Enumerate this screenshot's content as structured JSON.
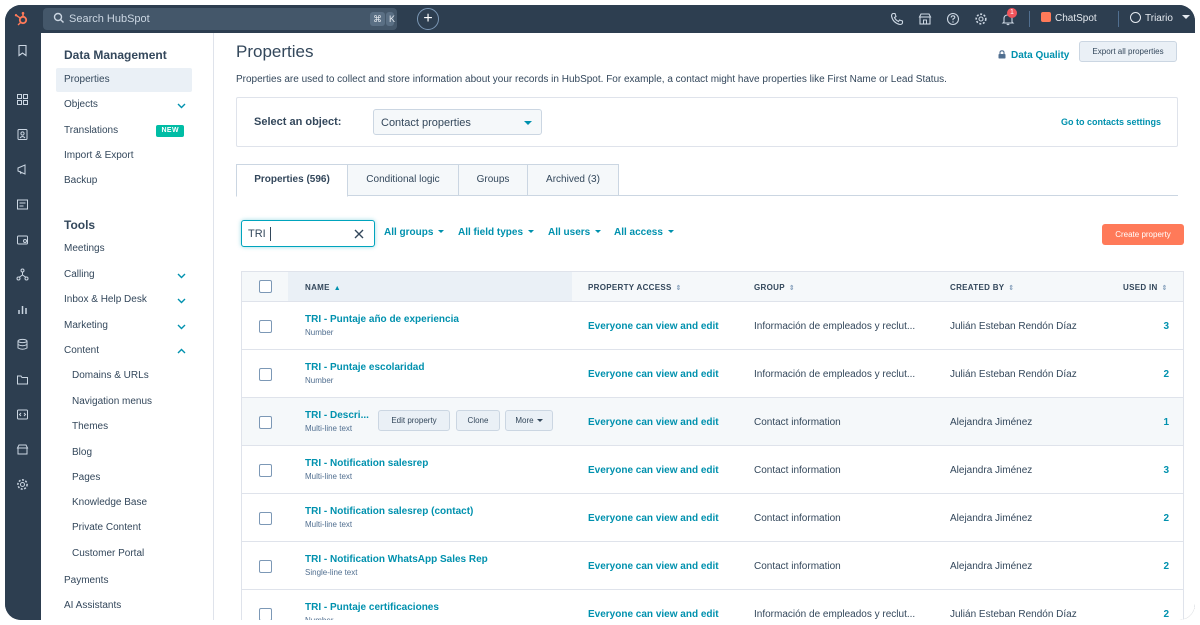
{
  "topbar": {
    "search_placeholder": "Search HubSpot",
    "shortcut_cmd": "⌘",
    "shortcut_key": "K",
    "notification_count": "1",
    "chatspot_label": "ChatSpot",
    "user_name": "Triario"
  },
  "sidebar": {
    "data_management_title": "Data Management",
    "data_items": [
      {
        "label": "Properties"
      },
      {
        "label": "Objects"
      },
      {
        "label": "Translations",
        "badge": "NEW"
      },
      {
        "label": "Import & Export"
      },
      {
        "label": "Backup"
      }
    ],
    "tools_title": "Tools",
    "tool_items": [
      {
        "label": "Meetings"
      },
      {
        "label": "Calling"
      },
      {
        "label": "Inbox & Help Desk"
      },
      {
        "label": "Marketing"
      },
      {
        "label": "Content"
      },
      {
        "label": "Domains & URLs"
      },
      {
        "label": "Navigation menus"
      },
      {
        "label": "Themes"
      },
      {
        "label": "Blog"
      },
      {
        "label": "Pages"
      },
      {
        "label": "Knowledge Base"
      },
      {
        "label": "Private Content"
      },
      {
        "label": "Customer Portal"
      },
      {
        "label": "Payments"
      },
      {
        "label": "AI Assistants"
      }
    ]
  },
  "main": {
    "title": "Properties",
    "description": "Properties are used to collect and store information about your records in HubSpot. For example, a contact might have properties like First Name or Lead Status.",
    "data_quality_label": "Data Quality",
    "export_label": "Export all properties",
    "select_object_label": "Select an object:",
    "selected_object": "Contact properties",
    "go_to_settings_label": "Go to contacts settings",
    "tabs": [
      {
        "label": "Properties (596)"
      },
      {
        "label": "Conditional logic"
      },
      {
        "label": "Groups"
      },
      {
        "label": "Archived (3)"
      }
    ],
    "search_value": "TRI",
    "filters": [
      {
        "label": "All groups"
      },
      {
        "label": "All field types"
      },
      {
        "label": "All users"
      },
      {
        "label": "All access"
      }
    ],
    "create_label": "Create property",
    "table": {
      "headers": {
        "name": "NAME",
        "access": "PROPERTY ACCESS",
        "group": "GROUP",
        "created_by": "CREATED BY",
        "used_in": "USED IN"
      },
      "row_actions": {
        "edit": "Edit property",
        "clone": "Clone",
        "more": "More"
      },
      "rows": [
        {
          "name": "TRI - Puntaje año de experiencia",
          "type": "Number",
          "access": "Everyone can view and edit",
          "group": "Información de empleados y reclut...",
          "created_by": "Julián Esteban Rendón Díaz",
          "used_in": "3"
        },
        {
          "name": "TRI - Puntaje escolaridad",
          "type": "Number",
          "access": "Everyone can view and edit",
          "group": "Información de empleados y reclut...",
          "created_by": "Julián Esteban Rendón Díaz",
          "used_in": "2"
        },
        {
          "name": "TRI - Descri...",
          "type": "Multi-line text",
          "access": "Everyone can view and edit",
          "group": "Contact information",
          "created_by": "Alejandra Jiménez",
          "used_in": "1"
        },
        {
          "name": "TRI - Notification salesrep",
          "type": "Multi-line text",
          "access": "Everyone can view and edit",
          "group": "Contact information",
          "created_by": "Alejandra Jiménez",
          "used_in": "3"
        },
        {
          "name": "TRI - Notification salesrep (contact)",
          "type": "Multi-line text",
          "access": "Everyone can view and edit",
          "group": "Contact information",
          "created_by": "Alejandra Jiménez",
          "used_in": "2"
        },
        {
          "name": "TRI - Notification WhatsApp Sales Rep",
          "type": "Single-line text",
          "access": "Everyone can view and edit",
          "group": "Contact information",
          "created_by": "Alejandra Jiménez",
          "used_in": "2"
        },
        {
          "name": "TRI - Puntaje certificaciones",
          "type": "Number",
          "access": "Everyone can view and edit",
          "group": "Información de empleados y reclut...",
          "created_by": "Julián Esteban Rendón Díaz",
          "used_in": "2"
        }
      ]
    }
  },
  "colors": {
    "topbar": "#2d3e50",
    "link": "#0091ae",
    "accent": "#ff7a59",
    "new_badge": "#00bda5"
  }
}
